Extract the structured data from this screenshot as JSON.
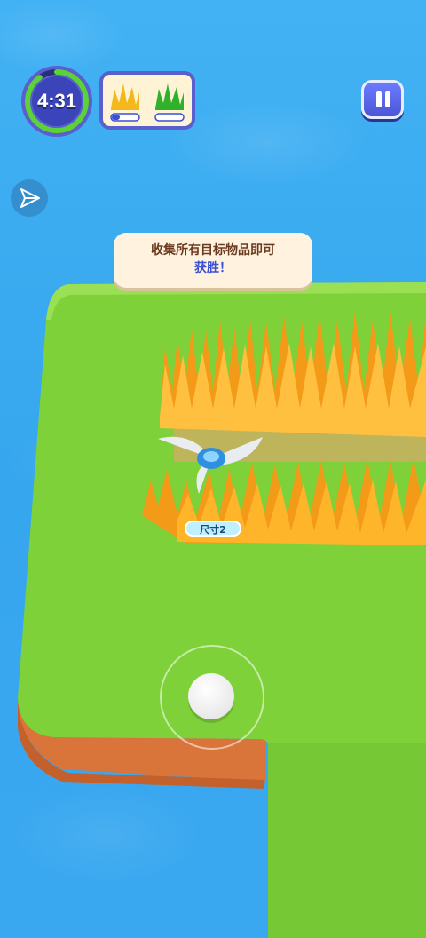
{
  "hud": {
    "timer": "4:31",
    "timer_progress": 0.9,
    "targets": [
      {
        "name": "yellow-grass",
        "color": "#f4b81c",
        "progress": 0.3
      },
      {
        "name": "green-grass",
        "color": "#2fb12c",
        "progress": 0.0
      }
    ]
  },
  "hint": {
    "line1": "收集所有目标物品即可",
    "line2": "获胜！"
  },
  "player": {
    "size_label": "尺寸2"
  },
  "colors": {
    "water": "#3aaaf0",
    "grass": "#7fd13a",
    "dirt": "#d9743a",
    "wheat": "#f39a18",
    "accent": "#5a5fd0"
  }
}
